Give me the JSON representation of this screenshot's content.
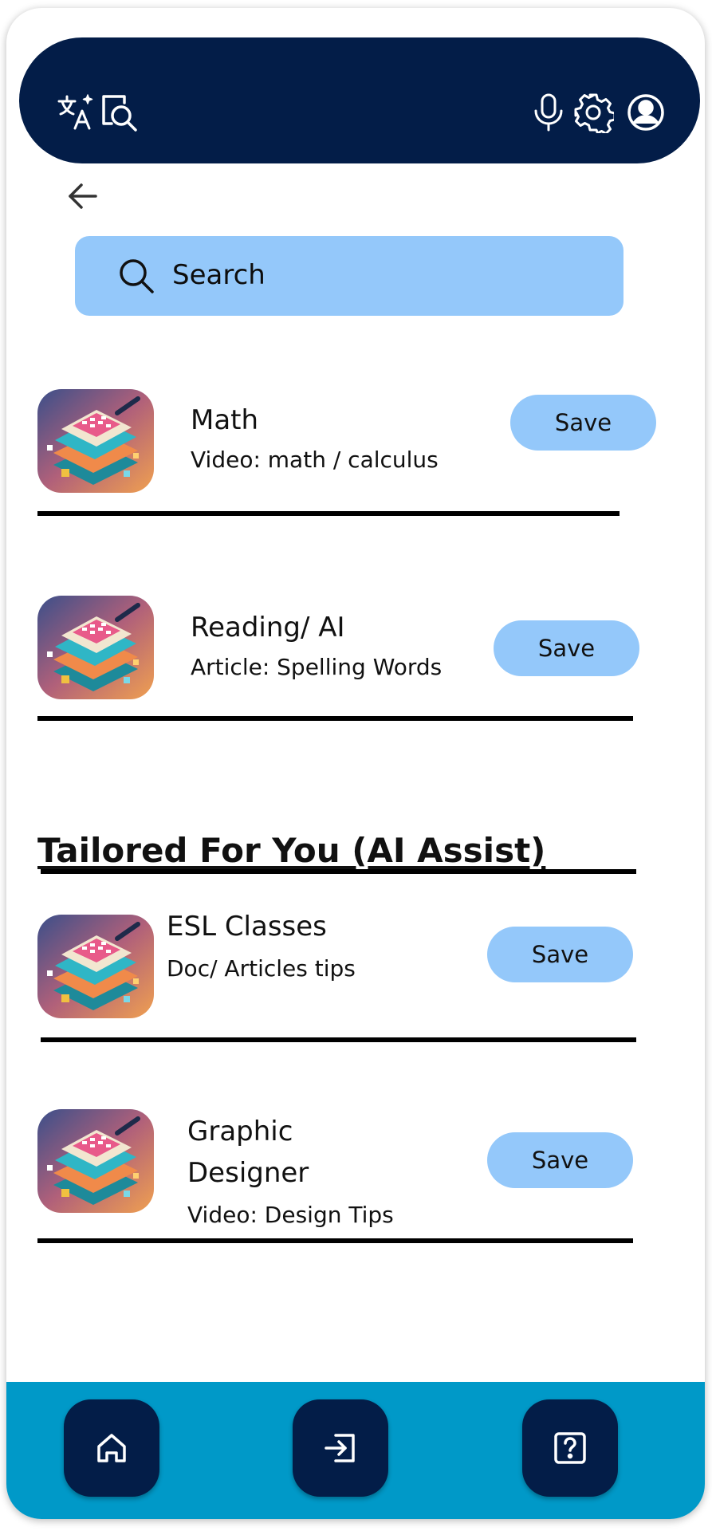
{
  "colors": {
    "header_bg": "#031d48",
    "accent_light_blue": "#94c8fa",
    "bottom_bar": "#0099c8",
    "divider": "#000000"
  },
  "header": {
    "icons": [
      "translate-icon",
      "search-document-icon",
      "microphone-icon",
      "gear-icon",
      "account-icon"
    ]
  },
  "search": {
    "placeholder": "Search"
  },
  "items": [
    {
      "title": "Math",
      "subtitle": "Video: math / calculus",
      "save_label": "Save"
    },
    {
      "title": "Reading/ AI",
      "subtitle": "Article: Spelling Words",
      "save_label": "Save"
    }
  ],
  "tailored": {
    "heading": "Tailored For You (AI Assist)",
    "items": [
      {
        "title": "ESL Classes",
        "subtitle": "Doc/ Articles tips",
        "save_label": "Save"
      },
      {
        "title_line1": "Graphic",
        "title_line2": "Designer",
        "subtitle": "Video: Design Tips",
        "save_label": "Save"
      }
    ]
  },
  "bottom_nav": {
    "icons": [
      "home-icon",
      "login-icon",
      "help-icon"
    ]
  }
}
